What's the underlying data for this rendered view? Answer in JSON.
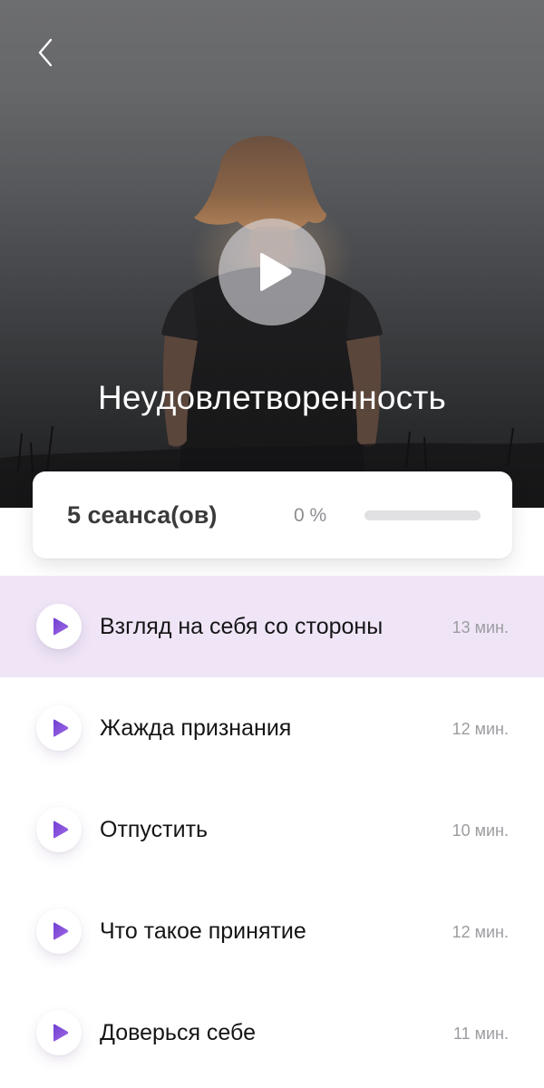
{
  "header": {
    "back_icon": "chevron-left-icon",
    "play_icon": "play-icon",
    "title": "Неудовлетворенность"
  },
  "summary": {
    "sessions_label": "5 сеанса(ов)",
    "progress_label": "0 %",
    "progress_value": 0
  },
  "colors": {
    "accent": "#8c5bd8",
    "active_row_bg": "#efe5f6"
  },
  "sessions": [
    {
      "title": "Взгляд на себя со стороны",
      "duration": "13 мин.",
      "active": true
    },
    {
      "title": "Жажда признания",
      "duration": "12 мин.",
      "active": false
    },
    {
      "title": "Отпустить",
      "duration": "10 мин.",
      "active": false
    },
    {
      "title": "Что такое принятие",
      "duration": "12 мин.",
      "active": false
    },
    {
      "title": "Доверься себе",
      "duration": "11 мин.",
      "active": false
    }
  ]
}
